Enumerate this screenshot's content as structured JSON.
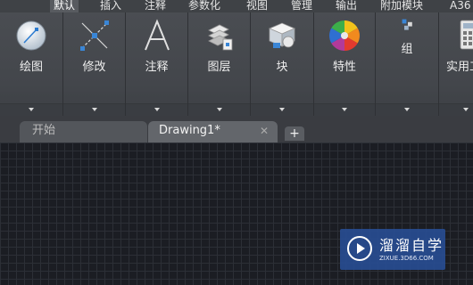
{
  "menu": {
    "tabs": [
      "默认",
      "插入",
      "注释",
      "参数化",
      "视图",
      "管理",
      "输出",
      "附加模块",
      "A36"
    ],
    "active": "默认"
  },
  "ribbon": {
    "panels": [
      {
        "label": "绘图",
        "icon": "draw-circle-icon"
      },
      {
        "label": "修改",
        "icon": "modify-move-icon"
      },
      {
        "label": "注释",
        "icon": "text-annotation-icon"
      },
      {
        "label": "图层",
        "icon": "layers-icon"
      },
      {
        "label": "块",
        "icon": "insert-block-icon"
      },
      {
        "label": "特性",
        "icon": "color-wheel-icon"
      },
      {
        "label": "组",
        "icon": "group-icon"
      },
      {
        "label": "实用工",
        "icon": "calculator-icon"
      }
    ]
  },
  "documents": {
    "tabs": [
      {
        "label": "开始",
        "active": false
      },
      {
        "label": "Drawing1*",
        "active": true,
        "close": "✕"
      }
    ],
    "new_tab": "+"
  },
  "watermark": {
    "title": "溜溜自学",
    "url": "ZIXUE.3D66.COM"
  },
  "colors": {
    "ribbon": "#43464b",
    "canvas": "#1b1d23",
    "grid": "#2c2f36",
    "watermark": "#284e96"
  }
}
